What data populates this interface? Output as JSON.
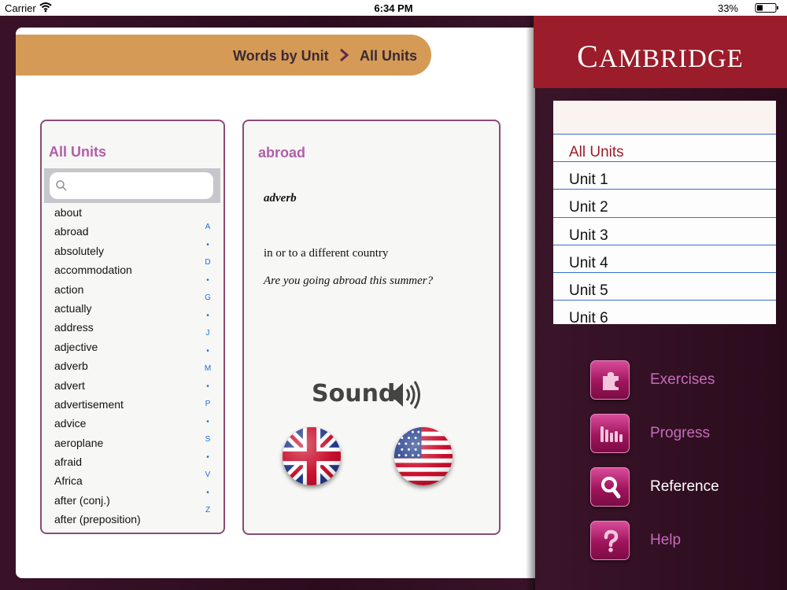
{
  "status_bar": {
    "carrier": "Carrier",
    "time": "6:34 PM",
    "battery": "33%"
  },
  "breadcrumb": {
    "parent": "Words by Unit",
    "current": "All Units"
  },
  "word_list": {
    "title": "All Units",
    "search_placeholder": "",
    "words": [
      "about",
      "abroad",
      "absolutely",
      "accommodation",
      "action",
      "actually",
      "address",
      "adjective",
      "adverb",
      "advert",
      "advertisement",
      "advice",
      "aeroplane",
      "afraid",
      "Africa",
      "after (conj.)",
      "after (preposition)"
    ],
    "index": [
      "A",
      "•",
      "D",
      "•",
      "G",
      "•",
      "J",
      "•",
      "M",
      "•",
      "P",
      "•",
      "S",
      "•",
      "V",
      "•",
      "Z"
    ]
  },
  "entry": {
    "word": "abroad",
    "part_of_speech": "adverb",
    "definition": "in or to a different country",
    "example": "Are you going abroad this summer?",
    "sound_label": "Sound"
  },
  "sidebar": {
    "brand": "CAMBRIDGE",
    "units": [
      "All Units",
      "Unit 1",
      "Unit 2",
      "Unit 3",
      "Unit 4",
      "Unit 5",
      "Unit 6"
    ],
    "active_unit": "All Units",
    "nav": [
      {
        "label": "Exercises",
        "icon": "puzzle-icon"
      },
      {
        "label": "Progress",
        "icon": "bar-chart-icon"
      },
      {
        "label": "Reference",
        "icon": "magnifier-icon"
      },
      {
        "label": "Help",
        "icon": "question-icon"
      }
    ],
    "active_nav": "Reference"
  },
  "colors": {
    "accent_purple": "#b15ea8",
    "brand_red": "#9b1c2a",
    "breadcrumb_orange": "#d59a55",
    "index_blue": "#1a6fe8"
  }
}
